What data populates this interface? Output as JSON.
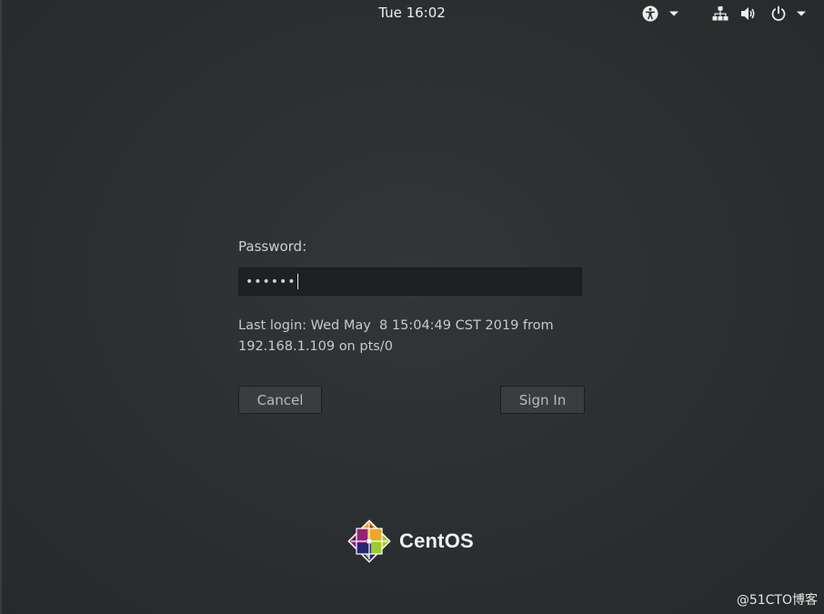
{
  "topbar": {
    "clock": "Tue 16:02",
    "icons": [
      "accessibility-icon",
      "chevron-down-icon",
      "network-icon",
      "volume-icon",
      "power-icon",
      "chevron-down-icon"
    ]
  },
  "login": {
    "password_label": "Password:",
    "password_value": "••••••",
    "last_login_line1": "Last login: Wed May  8 15:04:49 CST 2019 from",
    "last_login_line2": "192.168.1.109 on pts/0",
    "cancel_label": "Cancel",
    "signin_label": "Sign In"
  },
  "logo": {
    "text": "CentOS"
  },
  "watermark": "@51CTO博客",
  "colors": {
    "background": "#2c2f31",
    "field_bg": "#1e2022",
    "button_bg": "#3a3d3f",
    "text": "#d9d9d9"
  }
}
